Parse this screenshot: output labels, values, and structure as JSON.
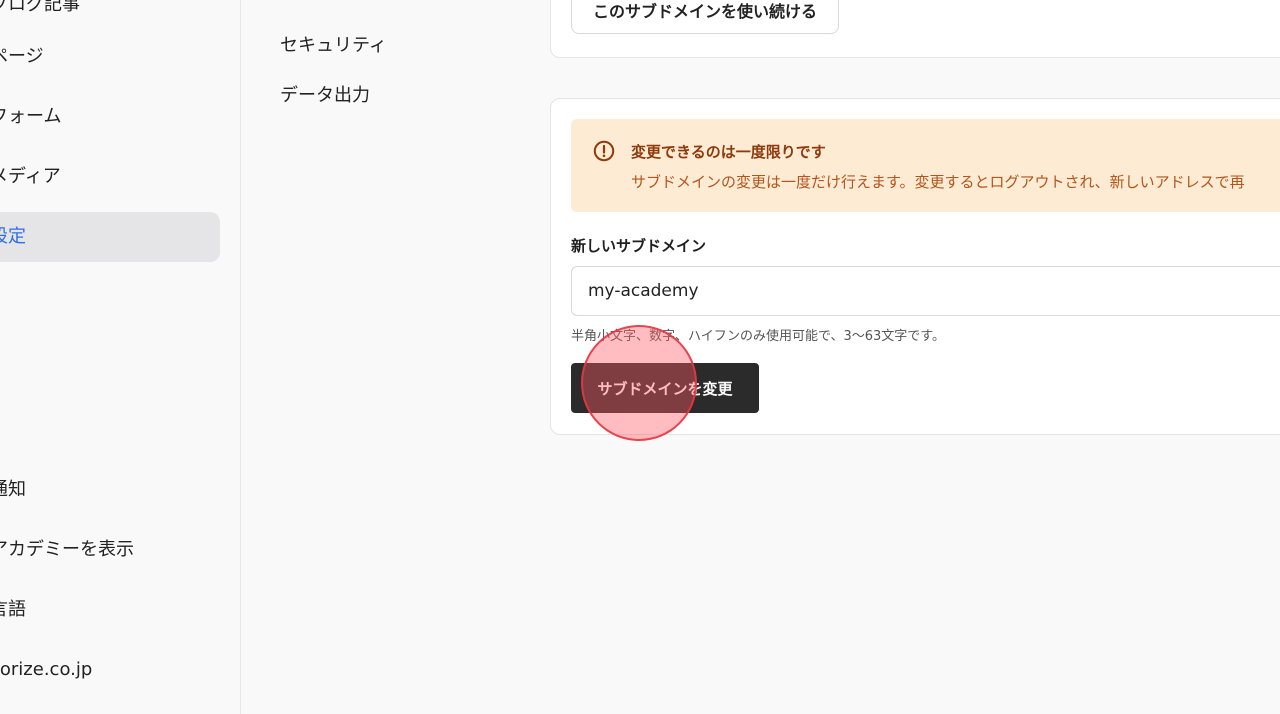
{
  "sidebar": {
    "items": [
      {
        "label": "ブログ記事"
      },
      {
        "label": "ページ"
      },
      {
        "label": "フォーム"
      },
      {
        "label": "メディア"
      },
      {
        "label": "設定"
      }
    ],
    "bottom_items": [
      {
        "label": "通知"
      },
      {
        "label": "アカデミーを表示"
      },
      {
        "label": "言語"
      },
      {
        "label": "corize.co.jp"
      }
    ]
  },
  "submenu": {
    "items": [
      {
        "label": "セキュリティ"
      },
      {
        "label": "データ出力"
      }
    ]
  },
  "top_card": {
    "keep_button_label": "このサブドメインを使い続ける"
  },
  "alert": {
    "title": "変更できるのは一度限りです",
    "body": "サブドメインの変更は一度だけ行えます。変更するとログアウトされ、新しいアドレスで再"
  },
  "form": {
    "label": "新しいサブドメイン",
    "value": "my-academy",
    "hint": "半角小文字、数字、ハイフンのみ使用可能で、3〜63文字です。",
    "submit_label": "サブドメインを変更"
  },
  "colors": {
    "accent": "#2e6ee6",
    "alert_bg": "#fdebd3",
    "alert_title": "#8e3a0e",
    "alert_body": "#b5541b",
    "primary_button": "#2b2b2b"
  }
}
